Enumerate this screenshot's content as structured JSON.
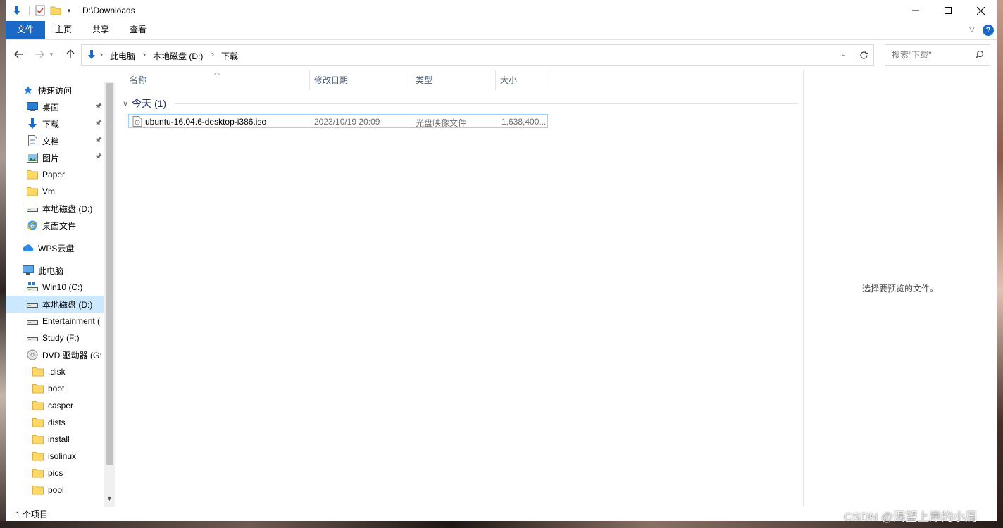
{
  "window": {
    "title": "D:\\Downloads",
    "controls": [
      "minimize",
      "maximize",
      "close"
    ]
  },
  "ribbon": {
    "tabs": [
      "文件",
      "主页",
      "共享",
      "查看"
    ],
    "help": "?"
  },
  "address": {
    "crumbs": [
      "此电脑",
      "本地磁盘 (D:)",
      "下载"
    ]
  },
  "search": {
    "placeholder": "搜索\"下载\""
  },
  "nav": {
    "items": [
      {
        "label": "快速访问",
        "icon": "star-icon",
        "indent": 0
      },
      {
        "label": "桌面",
        "icon": "desktop-icon",
        "indent": 1,
        "pinned": true
      },
      {
        "label": "下载",
        "icon": "download-icon",
        "indent": 1,
        "pinned": true
      },
      {
        "label": "文档",
        "icon": "document-icon",
        "indent": 1,
        "pinned": true
      },
      {
        "label": "图片",
        "icon": "picture-icon",
        "indent": 1,
        "pinned": true
      },
      {
        "label": "Paper",
        "icon": "folder-icon",
        "indent": 1
      },
      {
        "label": "Vm",
        "icon": "folder-icon",
        "indent": 1
      },
      {
        "label": "本地磁盘 (D:)",
        "icon": "drive-icon",
        "indent": 1
      },
      {
        "label": "桌面文件",
        "icon": "ie-icon",
        "indent": 1
      },
      {
        "label": "WPS云盘",
        "icon": "cloud-icon",
        "indent": 0
      },
      {
        "label": "此电脑",
        "icon": "computer-icon",
        "indent": 0
      },
      {
        "label": "Win10 (C:)",
        "icon": "windows-drive-icon",
        "indent": 1
      },
      {
        "label": "本地磁盘 (D:)",
        "icon": "drive-icon",
        "indent": 1,
        "selected": true
      },
      {
        "label": "Entertainment (",
        "icon": "drive-icon",
        "indent": 1
      },
      {
        "label": "Study (F:)",
        "icon": "drive-icon",
        "indent": 1
      },
      {
        "label": "DVD 驱动器 (G:",
        "icon": "dvd-icon",
        "indent": 1
      },
      {
        "label": ".disk",
        "icon": "folder-icon",
        "indent": 2
      },
      {
        "label": "boot",
        "icon": "folder-icon",
        "indent": 2
      },
      {
        "label": "casper",
        "icon": "folder-icon",
        "indent": 2
      },
      {
        "label": "dists",
        "icon": "folder-icon",
        "indent": 2
      },
      {
        "label": "install",
        "icon": "folder-icon",
        "indent": 2
      },
      {
        "label": "isolinux",
        "icon": "folder-icon",
        "indent": 2
      },
      {
        "label": "pics",
        "icon": "folder-icon",
        "indent": 2
      },
      {
        "label": "pool",
        "icon": "folder-icon",
        "indent": 2
      }
    ]
  },
  "filelist": {
    "columns": [
      "名称",
      "修改日期",
      "类型",
      "大小"
    ],
    "group": "今天 (1)",
    "rows": [
      {
        "name": "ubuntu-16.04.6-desktop-i386.iso",
        "date": "2023/10/19 20:09",
        "type": "光盘映像文件",
        "size": "1,638,400..."
      }
    ]
  },
  "preview": {
    "empty_text": "选择要预览的文件。"
  },
  "status": {
    "count": "1 个项目"
  },
  "watermark": "CSDN @渴望上岸的小周",
  "colors": {
    "accent": "#1a69c7",
    "selection": "#cce8ff",
    "selection_border": "#99d1ff",
    "group_header": "#1e3287"
  }
}
